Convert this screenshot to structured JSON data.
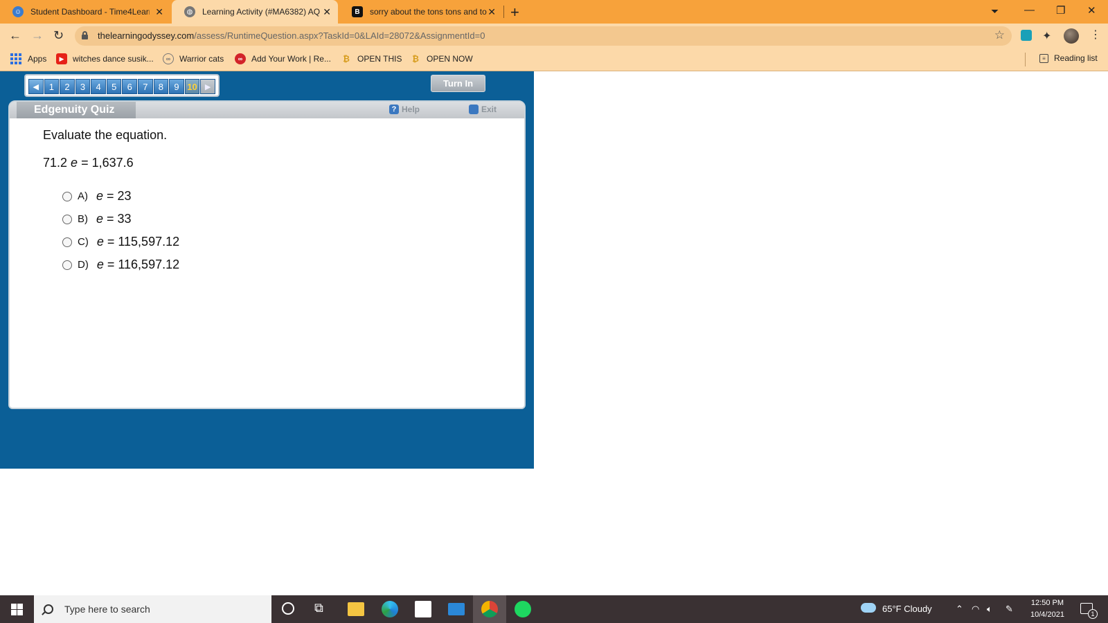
{
  "browser": {
    "tabs": [
      {
        "title": "Student Dashboard - Time4Learn",
        "active": false
      },
      {
        "title": "Learning Activity (#MA6382) AQ",
        "active": true
      },
      {
        "title": "sorry about the tons tons and to",
        "active": false
      }
    ],
    "url_host": "thelearningodyssey.com",
    "url_path": "/assess/RuntimeQuestion.aspx?TaskId=0&LAId=28072&AssignmentId=0",
    "bookmarks": [
      "Apps",
      "witches dance susik...",
      "Warrior cats",
      "Add Your Work | Re...",
      "OPEN THIS",
      "OPEN NOW"
    ],
    "reading_list": "Reading list"
  },
  "quiz": {
    "questions": [
      "1",
      "2",
      "3",
      "4",
      "5",
      "6",
      "7",
      "8",
      "9",
      "10"
    ],
    "current": "10",
    "turn_in": "Turn In",
    "title": "Edgenuity Quiz",
    "help": "Help",
    "exit": "Exit",
    "prompt": "Evaluate the equation.",
    "equation_left": "71.2 ",
    "equation_var": "e",
    "equation_right": " = 1,637.6",
    "options": [
      {
        "letter": "A)",
        "var": "e",
        "value": " = 23"
      },
      {
        "letter": "B)",
        "var": "e",
        "value": " = 33"
      },
      {
        "letter": "C)",
        "var": "e",
        "value": " = 115,597.12"
      },
      {
        "letter": "D)",
        "var": "e",
        "value": " = 116,597.12"
      }
    ]
  },
  "taskbar": {
    "search_placeholder": "Type here to search",
    "weather": "65°F  Cloudy",
    "time": "12:50 PM",
    "date": "10/4/2021",
    "notifications": "1"
  },
  "colors": {
    "chrome": "#f7a23b",
    "toolbar": "#fcd9a9",
    "app_bg": "#0b5f97",
    "taskbar": "#3a3133"
  }
}
